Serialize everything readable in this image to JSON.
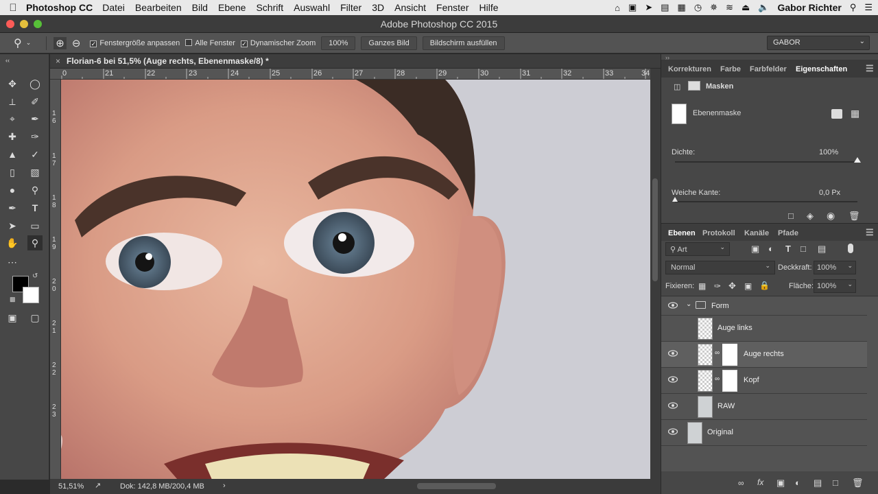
{
  "menubar": {
    "apple": "",
    "app_name": "Photoshop CC",
    "items": [
      "Datei",
      "Bearbeiten",
      "Bild",
      "Ebene",
      "Schrift",
      "Auswahl",
      "Filter",
      "3D",
      "Ansicht",
      "Fenster",
      "Hilfe"
    ],
    "user": "Gabor Richter"
  },
  "window": {
    "title": "Adobe Photoshop CC 2015"
  },
  "options": {
    "resize_windows": "Fenstergröße anpassen",
    "all_windows": "Alle Fenster",
    "scrubby_zoom": "Dynamischer Zoom",
    "zoom_value": "100%",
    "fit_screen": "Ganzes Bild",
    "fill_screen": "Bildschirm ausfüllen",
    "workspace": "GABOR"
  },
  "document": {
    "tab_title": "Florian-6 bei 51,5% (Auge rechts, Ebenenmaske/8) *",
    "ruler_ticks": [
      "0",
      "21",
      "22",
      "23",
      "24",
      "25",
      "26",
      "27",
      "28",
      "29",
      "30",
      "31",
      "32",
      "33",
      "34"
    ],
    "ruler_left_ticks": [
      "1 6",
      "1 7",
      "1 8",
      "1 9",
      "2 0",
      "2 1",
      "2 2",
      "2 3"
    ]
  },
  "status": {
    "zoom": "51,51%",
    "doc": "Dok: 142,8 MB/200,4 MB"
  },
  "properties": {
    "tabs": [
      "Korrekturen",
      "Farbe",
      "Farbfelder",
      "Eigenschaften"
    ],
    "header": "Masken",
    "mask_label": "Ebenenmaske",
    "density_label": "Dichte:",
    "density_value": "100%",
    "density_fraction": 1.0,
    "feather_label": "Weiche Kante:",
    "feather_value": "0,0 Px"
  },
  "layers_panel": {
    "tabs": [
      "Ebenen",
      "Protokoll",
      "Kanäle",
      "Pfade"
    ],
    "filter": "Art",
    "blend_mode": "Normal",
    "opacity_label": "Deckkraft:",
    "opacity_value": "100%",
    "lock_label": "Fixieren:",
    "fill_label": "Fläche:",
    "fill_value": "100%",
    "layers": [
      {
        "name": "Form"
      },
      {
        "name": "Auge links"
      },
      {
        "name": "Auge rechts"
      },
      {
        "name": "Kopf"
      },
      {
        "name": "RAW"
      },
      {
        "name": "Original"
      }
    ]
  }
}
